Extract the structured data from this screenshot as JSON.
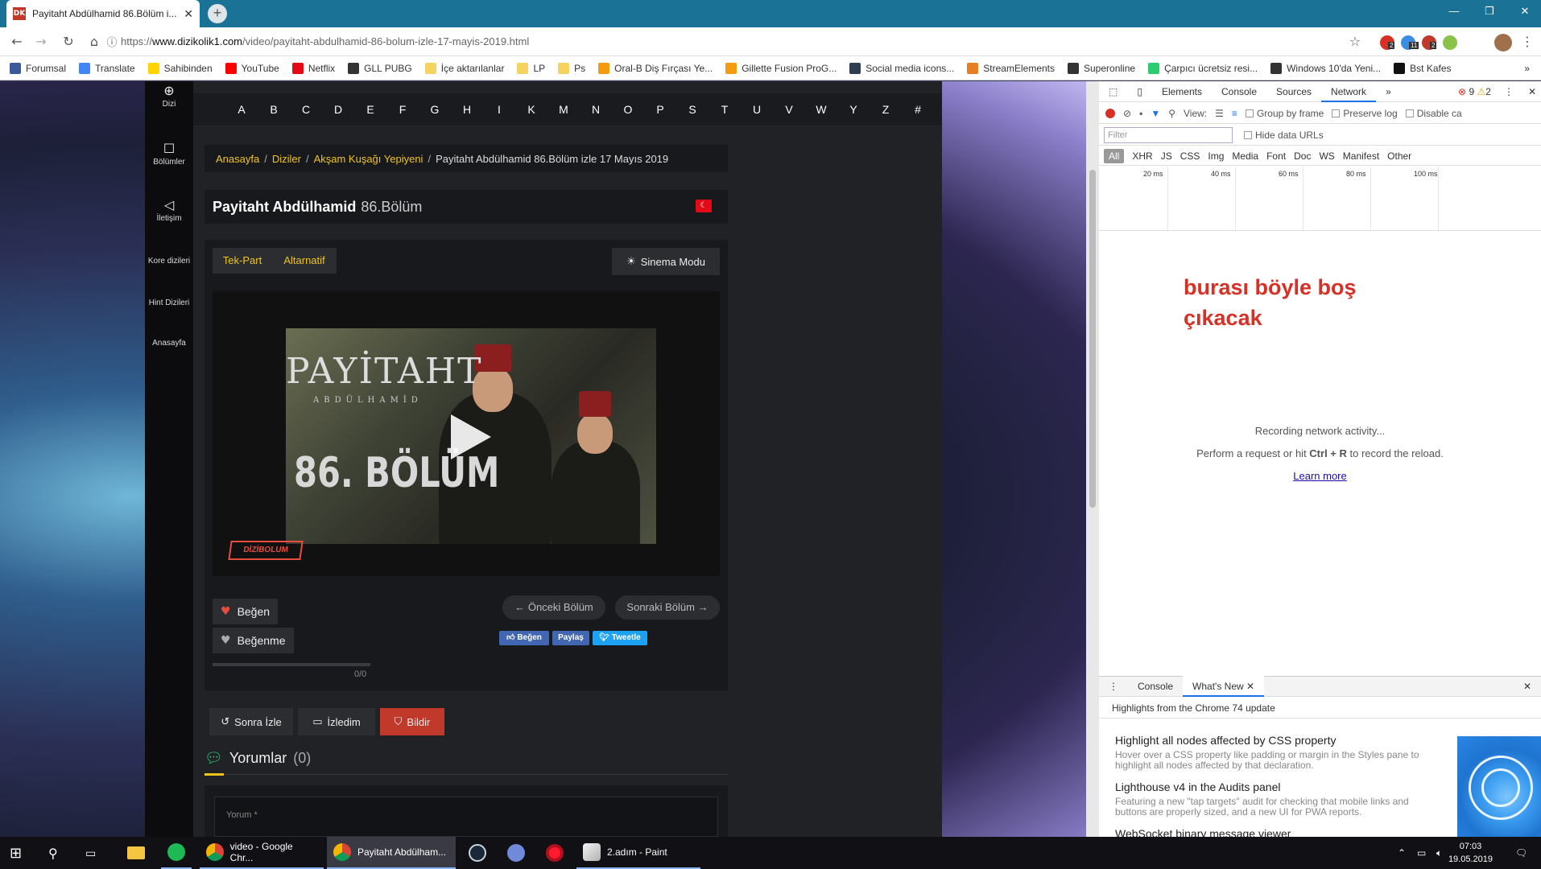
{
  "browser": {
    "tab_title": "Payitaht Abdülhamid 86.Bölüm i...",
    "tab_favicon": "DK",
    "new_tab": "+",
    "url_prefix": "https://",
    "url_domain": "www.dizikolik1.com",
    "url_path": "/video/payitaht-abdulhamid-86-bolum-izle-17-mayis-2019.html",
    "ext_badges": [
      "2",
      "11",
      "2"
    ],
    "bookmarks": [
      {
        "label": "Forumsal",
        "color": "#3b5998"
      },
      {
        "label": "Translate",
        "color": "#4285f4"
      },
      {
        "label": "Sahibinden",
        "color": "#ffd400"
      },
      {
        "label": "YouTube",
        "color": "#ff0000"
      },
      {
        "label": "Netflix",
        "color": "#e50914"
      },
      {
        "label": "GLL PUBG",
        "color": "#333333"
      },
      {
        "label": "İçe aktarılanlar",
        "color": "#f4d35e"
      },
      {
        "label": "LP",
        "color": "#f4d35e"
      },
      {
        "label": "Ps",
        "color": "#f4d35e"
      },
      {
        "label": "Oral-B Diş Fırçası Ye...",
        "color": "#f39c12"
      },
      {
        "label": "Gillette Fusion ProG...",
        "color": "#f39c12"
      },
      {
        "label": "Social media icons...",
        "color": "#2c3e50"
      },
      {
        "label": "StreamElements",
        "color": "#e67e22"
      },
      {
        "label": "Superonline",
        "color": "#333333"
      },
      {
        "label": "Çarpıcı ücretsiz resi...",
        "color": "#2ecc71"
      },
      {
        "label": "Windows 10'da Yeni...",
        "color": "#333333"
      },
      {
        "label": "Bst Kafes",
        "color": "#111111"
      }
    ],
    "more_bookmarks": "»"
  },
  "site": {
    "sidebar": [
      {
        "label": "Dizi",
        "icon": "globe-icon"
      },
      {
        "label": "Bölümler",
        "icon": "square-icon"
      },
      {
        "label": "İletişim",
        "icon": "megaphone-icon"
      },
      {
        "label": "Kore dizileri",
        "icon": ""
      },
      {
        "label": "Hint Dizileri",
        "icon": ""
      },
      {
        "label": "Anasayfa",
        "icon": ""
      }
    ],
    "alphabet": [
      "A",
      "B",
      "C",
      "D",
      "E",
      "F",
      "G",
      "H",
      "I",
      "K",
      "M",
      "N",
      "O",
      "P",
      "S",
      "T",
      "U",
      "V",
      "W",
      "Y",
      "Z",
      "#"
    ],
    "breadcrumb": [
      "Anasayfa",
      "Diziler",
      "Akşam Kuşağı Yepiyeni",
      "Payitaht Abdülhamid 86.Bölüm izle 17 Mayıs 2019"
    ],
    "breadcrumb_sep": "/",
    "title_main": "Payitaht Abdülhamid",
    "title_episode": "86.Bölüm",
    "sources": [
      "Tek-Part",
      "Altarnatif"
    ],
    "cinema_mode": "Sinema Modu",
    "thumb_title": "PAYİTAHT",
    "thumb_sub": "ABDÜLHAMİD",
    "thumb_episode": "86. BÖLÜM",
    "channel_logo": "DİZİBOLUM",
    "like": "Beğen",
    "dislike": "Beğenme",
    "vote_count": "0/0",
    "prev_episode": "← Önceki Bölüm",
    "next_episode": "Sonraki Bölüm →",
    "social": [
      {
        "label": "Beğen",
        "color": "#4267b2"
      },
      {
        "label": "Paylaş",
        "color": "#4267b2"
      },
      {
        "label": "Tweetle",
        "color": "#1da1f2"
      }
    ],
    "watch_later": "Sonra İzle",
    "watched": "İzledim",
    "report": "Bildir",
    "comments_title": "Yorumlar",
    "comments_count": "(0)",
    "comment_placeholder": "Yorum *"
  },
  "devtools": {
    "tabs": [
      "Elements",
      "Console",
      "Sources",
      "Network",
      "»"
    ],
    "errors": "9",
    "warnings": "2",
    "view_label": "View:",
    "group_by_frame": "Group by frame",
    "preserve_log": "Preserve log",
    "disable_cache": "Disable ca",
    "filter_placeholder": "Filter",
    "hide_data_urls": "Hide data URLs",
    "types": [
      "All",
      "XHR",
      "JS",
      "CSS",
      "Img",
      "Media",
      "Font",
      "Doc",
      "WS",
      "Manifest",
      "Other"
    ],
    "ticks": [
      "20 ms",
      "40 ms",
      "60 ms",
      "80 ms",
      "100 ms"
    ],
    "annotation_line1": "burası böyle boş",
    "annotation_line2": "çıkacak",
    "recording": "Recording network activity...",
    "perform_pre": "Perform a request or hit ",
    "perform_keys": "Ctrl + R",
    "perform_post": " to record the reload.",
    "learn_more": "Learn more",
    "drawer_tabs": [
      "Console",
      "What's New"
    ],
    "highlights": "Highlights from the Chrome 74 update",
    "news": [
      {
        "h": "Highlight all nodes affected by CSS property",
        "d": "Hover over a CSS property like padding or margin in the Styles pane to highlight all nodes affected by that declaration."
      },
      {
        "h": "Lighthouse v4 in the Audits panel",
        "d": "Featuring a new \"tap targets\" audit for checking that mobile links and buttons are properly sized, and a new UI for PWA reports."
      },
      {
        "h": "WebSocket binary message viewer",
        "d": ""
      }
    ]
  },
  "taskbar": {
    "items": [
      "video - Google Chr...",
      "Payitaht Abdülham...",
      "2.adım - Paint"
    ],
    "time": "07:03",
    "date": "19.05.2019"
  }
}
